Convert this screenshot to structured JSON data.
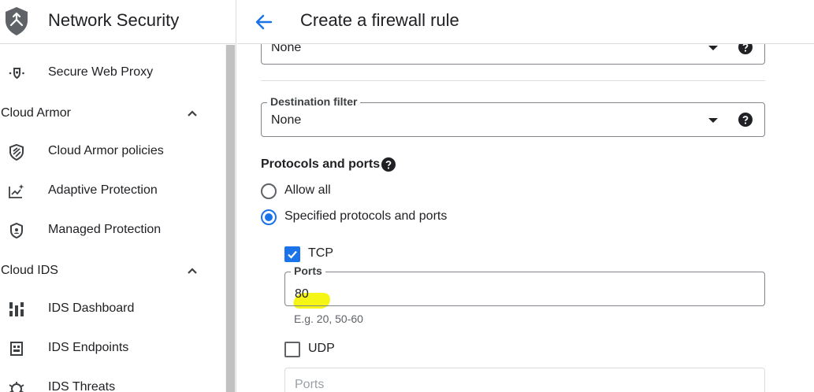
{
  "sidebar": {
    "product_title": "Network Security",
    "items": [
      {
        "label": "Secure Web Proxy",
        "icon": "secure-web-proxy-icon"
      },
      {
        "label": "Cloud Armor policies",
        "icon": "shield-icon"
      },
      {
        "label": "Adaptive Protection",
        "icon": "analytics-icon"
      },
      {
        "label": "Managed Protection",
        "icon": "security-icon"
      },
      {
        "label": "IDS Dashboard",
        "icon": "dashboard-icon"
      },
      {
        "label": "IDS Endpoints",
        "icon": "endpoint-icon"
      },
      {
        "label": "IDS Threats",
        "icon": "threats-icon"
      }
    ],
    "sections": [
      {
        "label": "Cloud Armor",
        "expanded": true
      },
      {
        "label": "Cloud IDS",
        "expanded": true
      }
    ]
  },
  "topbar": {
    "title": "Create a firewall rule"
  },
  "form": {
    "prev_select_value": "None",
    "destination_filter": {
      "label": "Destination filter",
      "value": "None"
    },
    "protocols_heading": "Protocols and ports",
    "radio_allow_all": "Allow all",
    "radio_specified": "Specified protocols and ports",
    "selected_radio": "Specified protocols and ports",
    "tcp": {
      "label": "TCP",
      "checked": true,
      "ports_label": "Ports",
      "ports_value": "80",
      "hint": "E.g. 20, 50-60"
    },
    "udp": {
      "label": "UDP",
      "checked": false,
      "ports_placeholder": "Ports"
    }
  },
  "colors": {
    "accent": "#1a73e8",
    "highlight": "#f5f500"
  }
}
